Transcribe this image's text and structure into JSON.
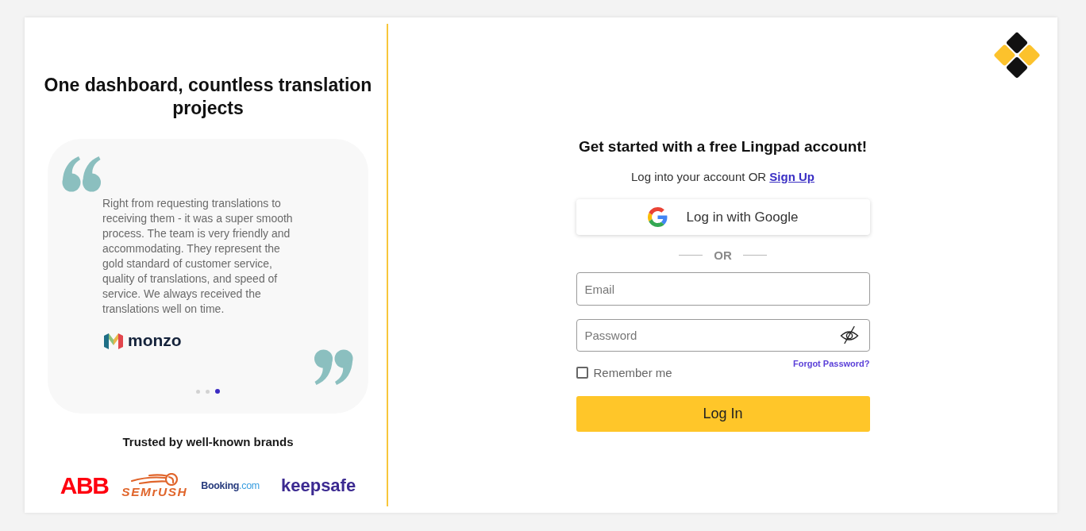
{
  "left": {
    "title": "One dashboard, countless translation projects",
    "testimonial": {
      "quote": "Right from requesting translations to receiving them - it was a super smooth process. The team is very friendly and accommodating. They represent the gold standard of customer service, quality of translations, and speed of service. We always received the translations well on time.",
      "company": "monzo",
      "dots": [
        {
          "selected": false
        },
        {
          "selected": false
        },
        {
          "selected": true
        }
      ]
    },
    "brands_heading": "Trusted by well-known brands",
    "brands": [
      {
        "kind": "block",
        "name": "ABB",
        "color": "#ff000f"
      },
      {
        "kind": "flame",
        "name": "SEMrUSH",
        "color": "#e0652b"
      },
      {
        "kind": "twotone",
        "name": "Booking",
        "suffix": ".com",
        "color": "#273b7d"
      },
      {
        "kind": "wordmark",
        "name": "keepsafe",
        "color": "#3c2a91"
      }
    ]
  },
  "right": {
    "heading": "Get started with a free Lingpad account!",
    "subtitle": "Log into your account OR",
    "signup_link": "Sign Up",
    "google_button": "Log in with Google",
    "divider": "OR",
    "email": {
      "placeholder": "Email"
    },
    "password": {
      "placeholder": "Password"
    },
    "remember": {
      "label": "Remember me",
      "checked": false
    },
    "forgot_link": "Forgot Password?",
    "login_button": "Log In"
  }
}
